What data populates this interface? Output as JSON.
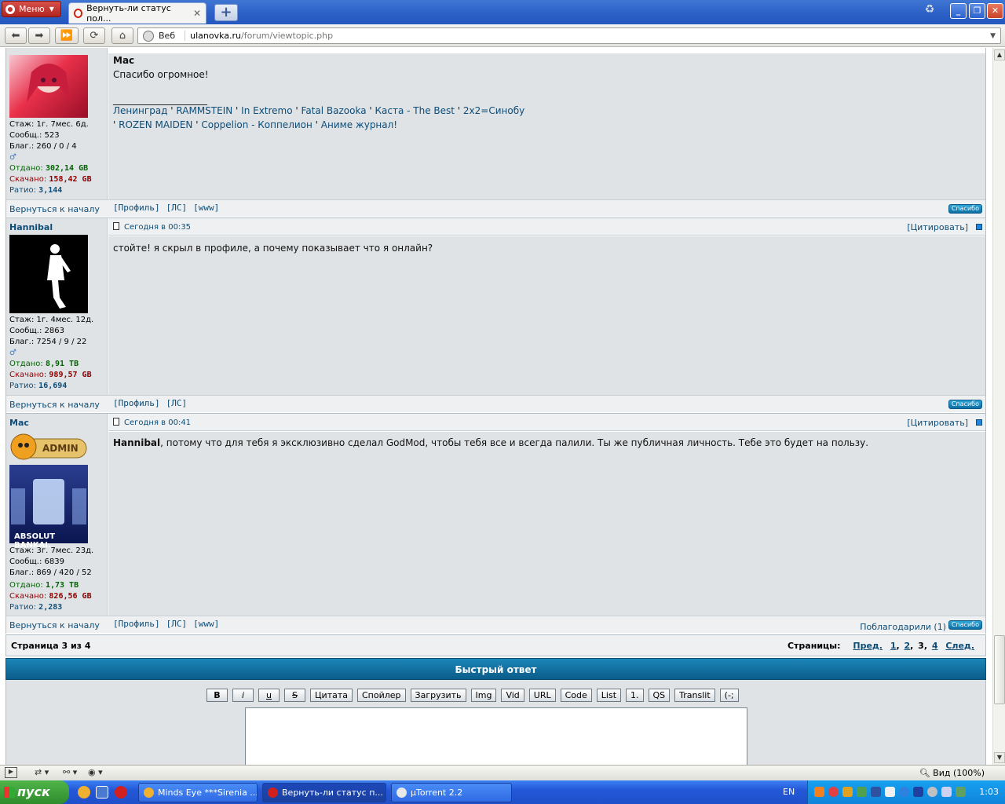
{
  "browser": {
    "menu_label": "Меню",
    "tab_title": "Вернуть-ли статус пол...",
    "address_web": "Веб",
    "address_host": "ulanovka.ru",
    "address_path": "/forum/viewtopic.php",
    "zoom": "Вид (100%)"
  },
  "posts": [
    {
      "author": "Mac",
      "stats": {
        "stazh": "Стаж: 1г. 7мес. 6д.",
        "msgs": "Сообщ.: 523",
        "blag": "Благ.: 260 / 0 / 4",
        "up_label": "Отдано:",
        "up": "302,14 GB",
        "down_label": "Скачано:",
        "down": "158,42 GB",
        "ratio_label": "Ратио:",
        "ratio": "3,144"
      },
      "body_name": "Mac",
      "body_text": "Спасибо огромное!",
      "signature_line": "____________________",
      "signature": [
        "Ленинград",
        "RAMMSTEIN",
        "In Extremo",
        "Fatal Bazooka",
        "Каста - The Best",
        "2x2=Синобу",
        "ROZEN MAIDEN",
        "Coppelion - Коппелион",
        "Аниме журнал!"
      ],
      "back": "Вернуться к началу",
      "links": [
        "[Профиль]",
        "[ЛС]",
        "[www]"
      ],
      "thanks": "Спасибо"
    },
    {
      "author": "Hannibal",
      "date": "Сегодня в 00:35",
      "quote": "[Цитировать]",
      "stats": {
        "stazh": "Стаж: 1г. 4мес. 12д.",
        "msgs": "Сообщ.: 2863",
        "blag": "Благ.: 7254 / 9 / 22",
        "up_label": "Отдано:",
        "up": "8,91 TB",
        "down_label": "Скачано:",
        "down": "989,57 GB",
        "ratio_label": "Ратио:",
        "ratio": "16,694"
      },
      "body_text": "стойте! я скрыл в профиле, а почему показывает что я онлайн?",
      "back": "Вернуться к началу",
      "links": [
        "[Профиль]",
        "[ЛС]"
      ],
      "thanks": "Спасибо"
    },
    {
      "author": "Mac",
      "date": "Сегодня в 00:41",
      "quote": "[Цитировать]",
      "badge": "ADMIN",
      "avatar_caption": "ABSOLUT BANKAI.",
      "stats": {
        "stazh": "Стаж: 3г. 7мес. 23д.",
        "msgs": "Сообщ.: 6839",
        "blag": "Благ.: 869 / 420 / 52",
        "up_label": "Отдано:",
        "up": "1,73 TB",
        "down_label": "Скачано:",
        "down": "826,56 GB",
        "ratio_label": "Ратио:",
        "ratio": "2,283"
      },
      "body_name": "Hannibal",
      "body_text": ", потому что для тебя я эксклюзивно сделал GodMod, чтобы тебя все и всегда палили. Ты же публичная личность. Тебе это будет на пользу.",
      "back": "Вернуться к началу",
      "links": [
        "[Профиль]",
        "[ЛС]",
        "[www]"
      ],
      "thanked": "Поблагодарили (1)",
      "thanks": "Спасибо"
    }
  ],
  "pagination": {
    "left": "Страница 3 из 4",
    "label": "Страницы:",
    "prev": "Пред.",
    "p1": "1",
    "p2": "2",
    "p3": "3",
    "p4": "4",
    "next": "След."
  },
  "quick_reply": {
    "title": "Быстрый ответ",
    "buttons": [
      "B",
      "i",
      "u",
      "S",
      "Цитата",
      "Спойлер",
      "Загрузить",
      "Img",
      "Vid",
      "URL",
      "Code",
      "List",
      "1.",
      "QS",
      "Translit",
      "(-;"
    ]
  },
  "taskbar": {
    "start": "пуск",
    "tasks": [
      "Minds Eye ***Sirenia ...",
      "Вернуть-ли статус п...",
      "µTorrent 2.2"
    ],
    "lang": "EN",
    "clock": "1:03"
  }
}
